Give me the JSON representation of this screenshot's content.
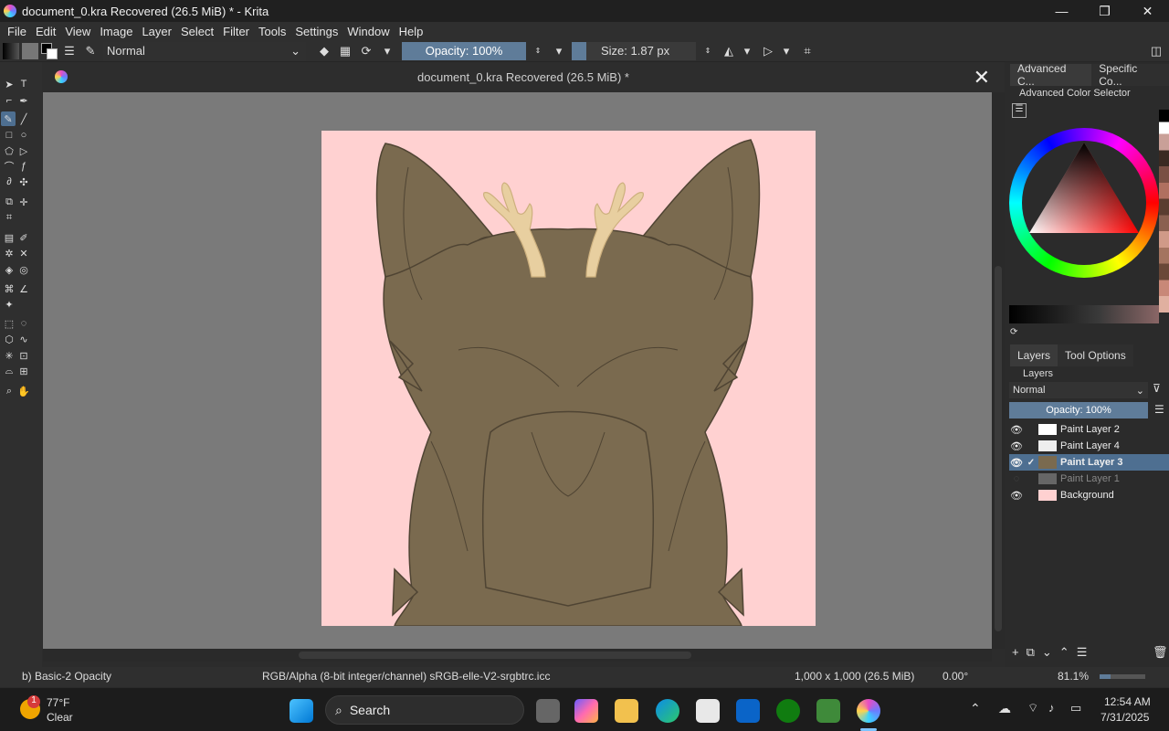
{
  "window": {
    "title": "document_0.kra Recovered (26.5 MiB) * - Krita",
    "minimize": "—",
    "restore": "❐",
    "close": "✕"
  },
  "menu": [
    "File",
    "Edit",
    "View",
    "Image",
    "Layer",
    "Select",
    "Filter",
    "Tools",
    "Settings",
    "Window",
    "Help"
  ],
  "toolbar": {
    "blend_mode": "Normal",
    "opacity": "Opacity: 100%",
    "size": "Size: 1.87 px"
  },
  "document_tab": {
    "title": "document_0.kra Recovered (26.5 MiB) *",
    "close": "✕"
  },
  "dockers": {
    "top_tabs": [
      "Advanced C...",
      "Specific Co..."
    ],
    "color_selector_title": "Advanced Color Selector",
    "bottom_tabs": [
      "Layers",
      "Tool Options"
    ],
    "layers_title": "Layers",
    "layer_blend": "Normal",
    "layer_opacity": "Opacity: 100%",
    "layers": [
      {
        "name": "Paint Layer 2",
        "visible": true,
        "selected": false
      },
      {
        "name": "Paint Layer 4",
        "visible": true,
        "selected": false
      },
      {
        "name": "Paint Layer 3",
        "visible": true,
        "selected": true
      },
      {
        "name": "Paint Layer 1",
        "visible": false,
        "selected": false
      },
      {
        "name": "Background",
        "visible": true,
        "selected": false
      }
    ]
  },
  "status": {
    "brush": "b) Basic-2 Opacity",
    "color_space": "RGB/Alpha (8-bit integer/channel)  sRGB-elle-V2-srgbtrc.icc",
    "dimensions": "1,000 x 1,000 (26.5 MiB)",
    "rotation": "0.00°",
    "zoom": "81.1%"
  },
  "taskbar": {
    "weather_temp": "77°F",
    "weather_desc": "Clear",
    "weather_badge": "1",
    "search": "Search",
    "time": "12:54 AM",
    "date": "7/31/2025"
  },
  "colors": {
    "canvas_bg": "#ffd1d1",
    "creature_fill": "#7a6a4f",
    "antler": "#e8cfa0",
    "accent": "#4e6f91"
  }
}
